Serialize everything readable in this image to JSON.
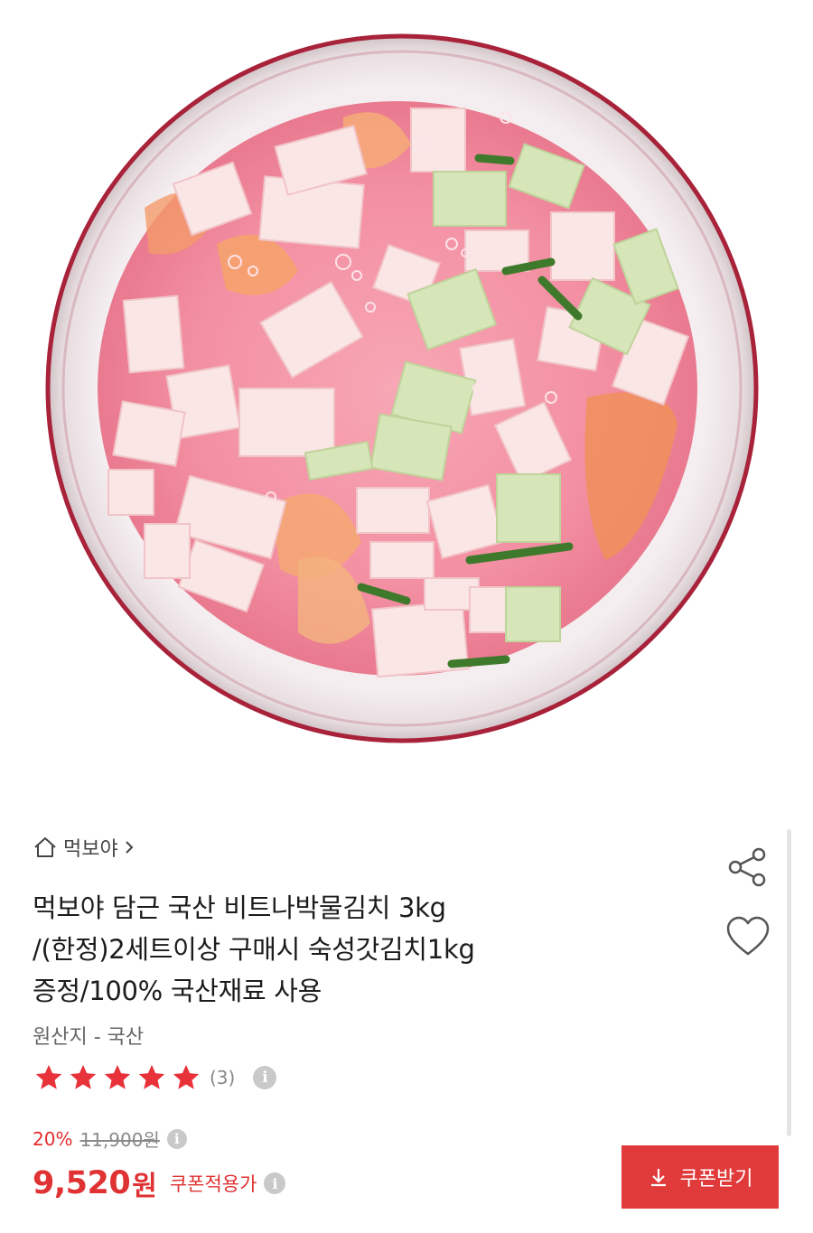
{
  "product": {
    "image_alt": "",
    "store_name": "먹보야",
    "title_lines": [
      "먹보야 담근 국산 비트나박물김치 3kg",
      "/(한정)2세트이상 구매시 숙성갓김치1kg",
      "증정/100% 국산재료 사용"
    ],
    "origin": "원산지 - 국산",
    "rating": {
      "stars": 5,
      "max": 5,
      "review_count": "(3)"
    },
    "price": {
      "discount_rate": "20%",
      "original": "11,900원",
      "sale": "9,520",
      "unit": "원",
      "coupon_label": "쿠폰적용가"
    },
    "coupon_button_label": "쿠폰받기"
  },
  "icons": {
    "home": "home-icon",
    "chevron": "chevron-right-icon",
    "share": "share-icon",
    "wish": "heart-icon",
    "info": "info-icon",
    "star": "star-icon",
    "download": "download-icon"
  },
  "colors": {
    "accent": "#e03232",
    "button": "#e03a3a",
    "star": "#e8323a",
    "muted": "#8a8a8a"
  }
}
